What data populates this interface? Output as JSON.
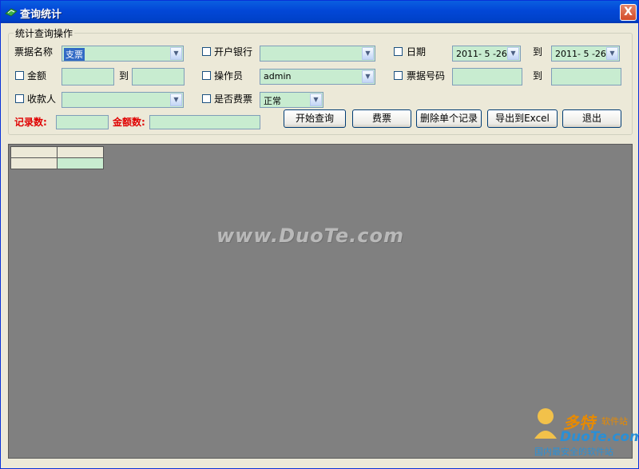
{
  "window": {
    "title": "查询统计",
    "close_glyph": "X"
  },
  "group": {
    "legend": "统计查询操作"
  },
  "row1": {
    "ticket_name_label": "票据名称",
    "ticket_name_value": "支票",
    "bank_label": "开户银行",
    "bank_value": "",
    "date_label": "日期",
    "date_from": "2011- 5 -26",
    "to_label": "到",
    "date_to": "2011- 5 -26"
  },
  "row2": {
    "amount_label": "金额",
    "amount_from": "",
    "to_label": "到",
    "amount_to": "",
    "operator_label": "操作员",
    "operator_value": "admin",
    "ticket_no_label": "票据号码",
    "ticket_no_from": "",
    "to_label2": "到",
    "ticket_no_to": ""
  },
  "row3": {
    "payee_label": "收款人",
    "payee_value": "",
    "fee_ticket_label": "是否费票",
    "fee_ticket_value": "正常"
  },
  "row4": {
    "record_count_label": "记录数:",
    "record_count_value": "",
    "amount_count_label": "金额数:",
    "amount_count_value": ""
  },
  "buttons": {
    "start_query": "开始查询",
    "fee_ticket": "费票",
    "delete_record": "删除单个记录",
    "export_excel": "导出到Excel",
    "exit": "退出"
  },
  "watermark": "www.DuoTe.com",
  "logo": {
    "cn": "多特",
    "sub": "软件站",
    "en": "DuoTe.com",
    "tag": "国内最安全的软件站"
  },
  "colors": {
    "title_bar": "#0348d8",
    "input_bg": "#c8ecd0",
    "grid_bg": "#808080",
    "red_label": "#e00000"
  }
}
